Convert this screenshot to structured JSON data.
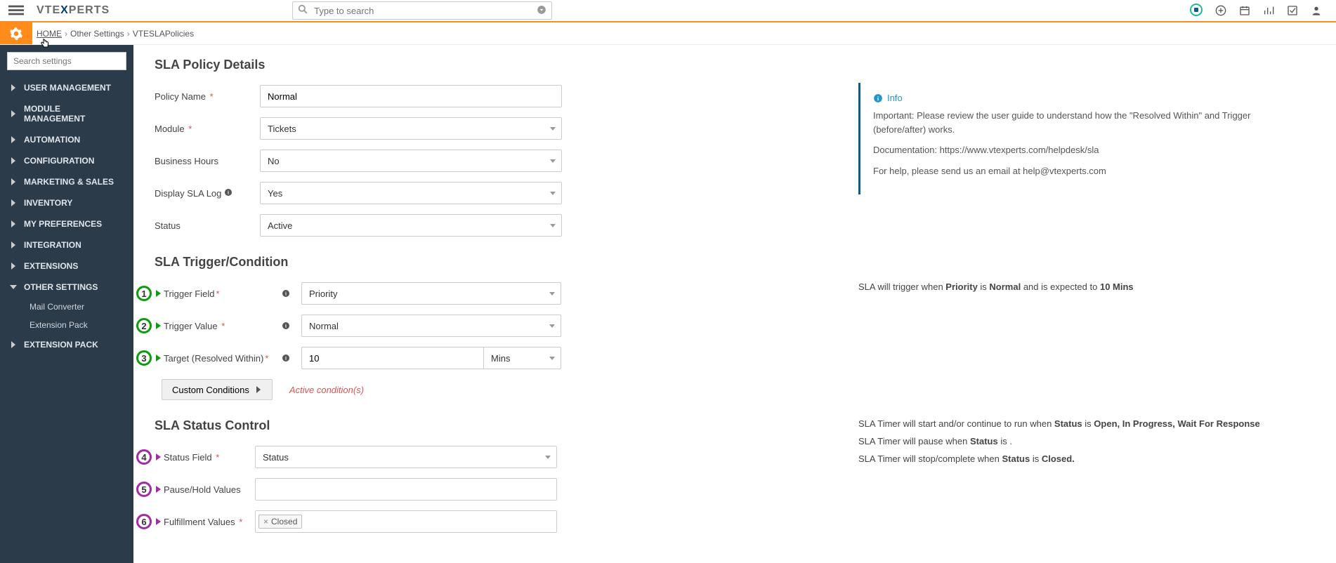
{
  "header": {
    "search_placeholder": "Type to search",
    "logo_text_pre": "VTE",
    "logo_text_x": "X",
    "logo_text_post": "PERTS"
  },
  "breadcrumb": {
    "home": "HOME",
    "other_settings": "Other Settings",
    "page": "VTESLAPolicies"
  },
  "sidebar": {
    "search_placeholder": "Search settings",
    "items": [
      "USER MANAGEMENT",
      "MODULE MANAGEMENT",
      "AUTOMATION",
      "CONFIGURATION",
      "MARKETING & SALES",
      "INVENTORY",
      "MY PREFERENCES",
      "INTEGRATION",
      "EXTENSIONS",
      "OTHER SETTINGS"
    ],
    "subs": [
      "Mail Converter",
      "Extension Pack"
    ],
    "last": "EXTENSION PACK"
  },
  "sections": {
    "details": "SLA Policy Details",
    "trigger": "SLA Trigger/Condition",
    "status": "SLA Status Control"
  },
  "form": {
    "policy_name_label": "Policy Name",
    "policy_name_value": "Normal",
    "module_label": "Module",
    "module_value": "Tickets",
    "business_hours_label": "Business Hours",
    "business_hours_value": "No",
    "display_sla_log_label": "Display SLA Log",
    "display_sla_log_value": "Yes",
    "status_label": "Status",
    "status_value": "Active"
  },
  "info": {
    "title": "Info",
    "p1": "Important: Please review the user guide to understand how the \"Resolved Within\" and Trigger (before/after) works.",
    "p2": "Documentation: https://www.vtexperts.com/helpdesk/sla",
    "p3": "For help, please send us an email at help@vtexperts.com"
  },
  "trigger": {
    "field_label": "Trigger Field",
    "field_value": "Priority",
    "value_label": "Trigger Value",
    "value_value": "Normal",
    "target_label": "Target (Resolved Within)",
    "target_num": "10",
    "target_unit": "Mins",
    "custom_btn": "Custom Conditions",
    "active_cond": "Active condition(s)",
    "summary_pre": "SLA will trigger when ",
    "summary_field": "Priority",
    "summary_is": " is ",
    "summary_val": "Normal",
    "summary_mid": " and is expected to ",
    "summary_time": "10 Mins"
  },
  "status": {
    "field_label": "Status Field",
    "field_value": "Status",
    "pause_label": "Pause/Hold Values",
    "fulfil_label": "Fulfillment Values",
    "fulfil_chip": "Closed",
    "s1_pre": "SLA Timer will start and/or continue to run when ",
    "s1_field": "Status",
    "s1_is": " is  ",
    "s1_vals": "Open, In Progress, Wait For Response",
    "s2_pre": "SLA Timer will pause when ",
    "s2_field": "Status",
    "s2_is": " is  .",
    "s3_pre": "SLA Timer will stop/complete when ",
    "s3_field": "Status",
    "s3_is": " is  ",
    "s3_val": "Closed."
  }
}
